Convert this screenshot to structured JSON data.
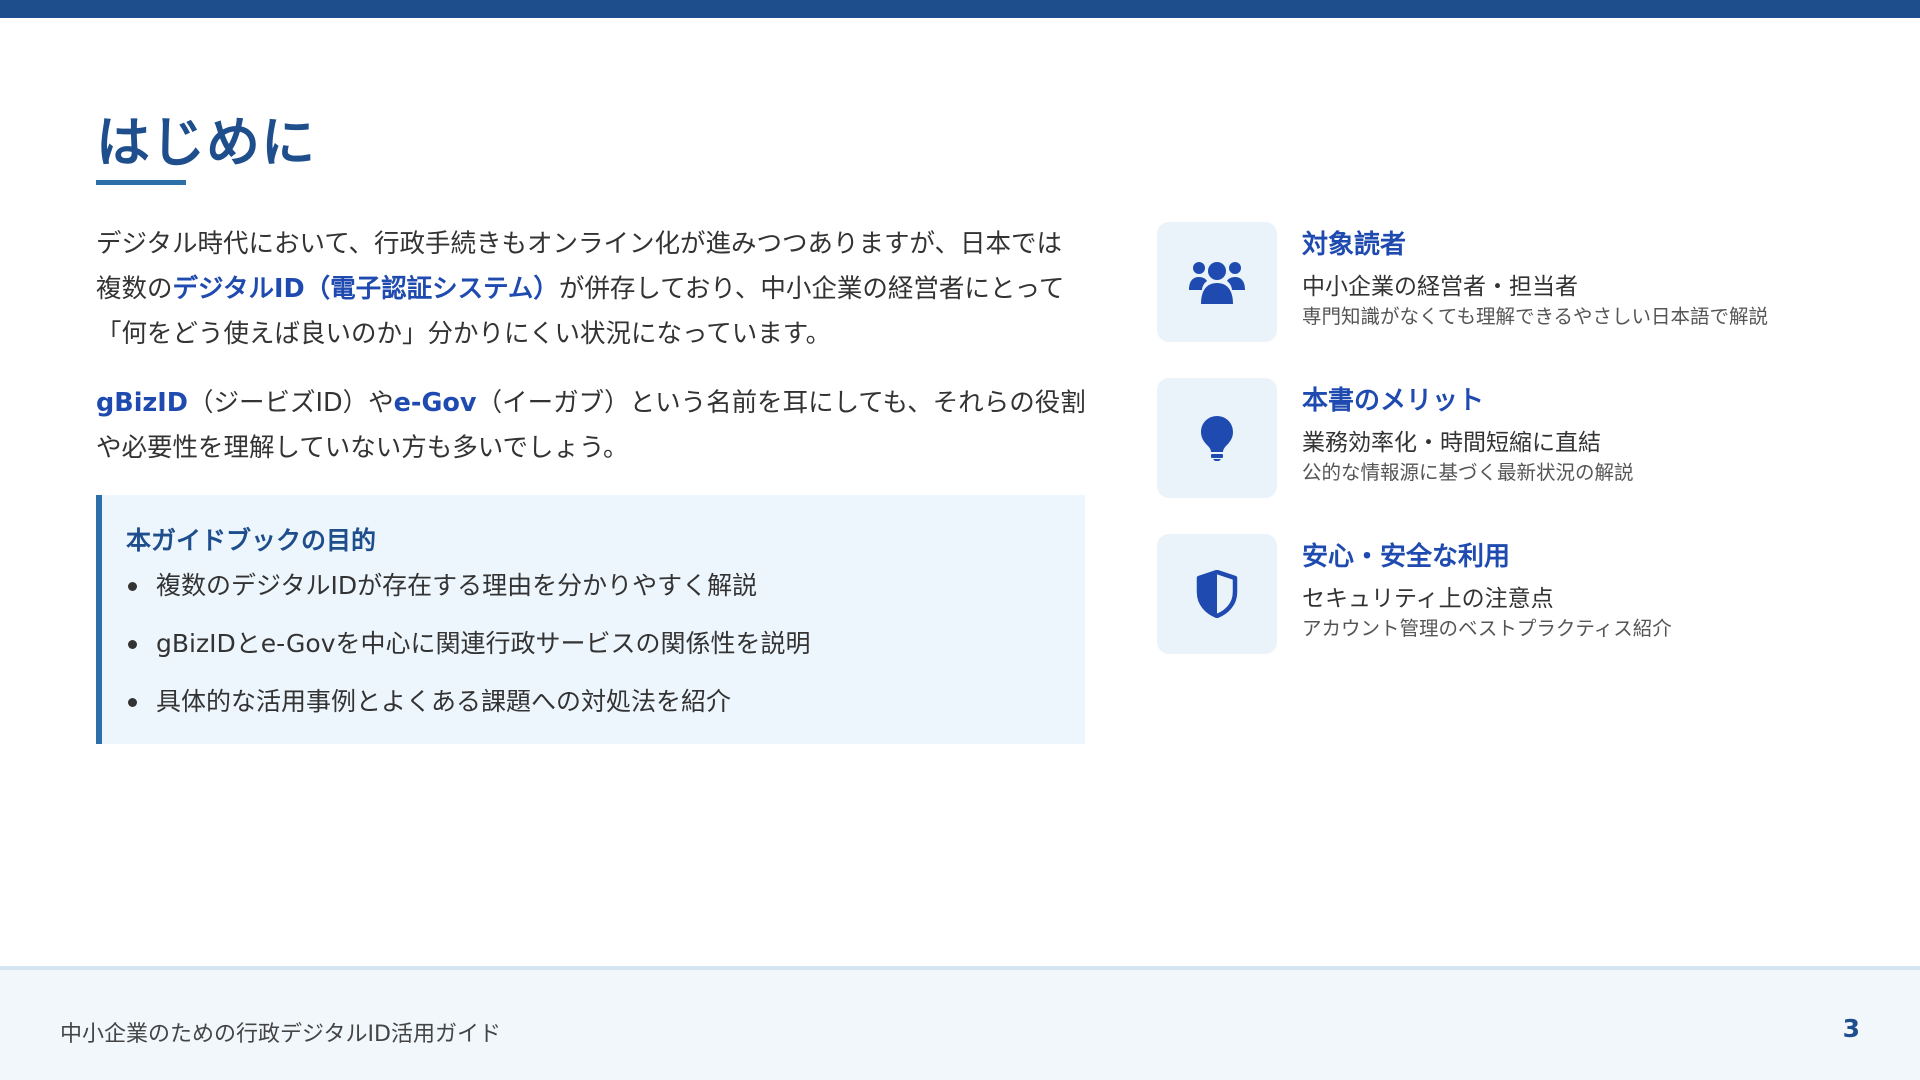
{
  "header": {
    "title": "はじめに"
  },
  "intro": {
    "p1_part1": "デジタル時代において、行政手続きもオンライン化が進みつつありますが、日本では複数の",
    "p1_highlight": "デジタルID（電子認証システム）",
    "p1_part2": "が併存しており、中小企業の経営者にとって「何をどう使えば良いのか」分かりにくい状況になっています。",
    "p2_gbizid": "gBizID",
    "p2_part1": "（ジービズID）や",
    "p2_egov": "e-Gov",
    "p2_part2": "（イーガブ）という名前を耳にしても、それらの役割や必要性を理解していない方も多いでしょう。"
  },
  "purpose": {
    "title": "本ガイドブックの目的",
    "items": [
      "複数のデジタルIDが存在する理由を分かりやすく解説",
      "gBizIDとe-Govを中心に関連行政サービスの関係性を説明",
      "具体的な活用事例とよくある課題への対処法を紹介"
    ]
  },
  "cards": [
    {
      "icon": "users-icon",
      "title": "対象読者",
      "main": "中小企業の経営者・担当者",
      "sub": "専門知識がなくても理解できるやさしい日本語で解説"
    },
    {
      "icon": "lightbulb-icon",
      "title": "本書のメリット",
      "main": "業務効率化・時間短縮に直結",
      "sub": "公的な情報源に基づく最新状況の解説"
    },
    {
      "icon": "shield-icon",
      "title": "安心・安全な利用",
      "main": "セキュリティ上の注意点",
      "sub": "アカウント管理のベストプラクティス紹介"
    }
  ],
  "footer": {
    "text": "中小企業のための行政デジタルID活用ガイド",
    "page_number": "3"
  },
  "colors": {
    "primary": "#1f4e8c",
    "accent": "#1f4bb0",
    "box_bg": "#eef6fd"
  }
}
